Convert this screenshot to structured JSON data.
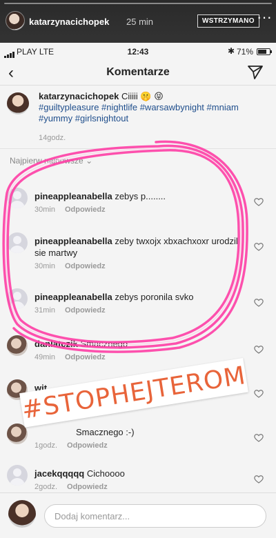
{
  "story": {
    "username": "katarzynacichopek",
    "time": "25 min",
    "paused_label": "WSTRZYMANO",
    "more_icon": "more-horizontal-icon"
  },
  "status_bar": {
    "carrier": "PLAY  LTE",
    "time": "12:43",
    "battery": "71%"
  },
  "nav": {
    "title": "Komentarze"
  },
  "caption": {
    "username": "katarzynacichopek",
    "text": " Ciiiii 🤫 😝",
    "tags": "#guiltypleasure #nightlife #warsawbynight #mniam #yummy #girlsnightout",
    "time": "14godz."
  },
  "sort_label": "Najpierw najnowsze",
  "reply_label": "Odpowiedz",
  "comments": [
    {
      "username": "pineappleanabella",
      "text": "zebys p........",
      "time": "30min"
    },
    {
      "username": "pineappleanabella",
      "text": "zeby twxojx xbxachxoxr urodzil sie martwy",
      "time": "30min"
    },
    {
      "username": "pineappleanabella",
      "text": "zebys poronila svko",
      "time": "31min"
    },
    {
      "username": "danlatczik",
      "text": "Smacznego",
      "time": "49min"
    },
    {
      "username": "wit",
      "text": "",
      "time": ""
    },
    {
      "username": "",
      "text": "Smacznego :-)",
      "time": "1godz."
    },
    {
      "username": "jacekqqqqq",
      "text": "Cichoooo",
      "time": "2godz."
    }
  ],
  "composer": {
    "placeholder": "Dodaj komentarz..."
  },
  "sticker": {
    "text": "#STOPHEJTEROM",
    "color": "#e8643a"
  },
  "colors": {
    "scribble": "#ff3fa6",
    "hashtag": "#1f4e8c"
  }
}
